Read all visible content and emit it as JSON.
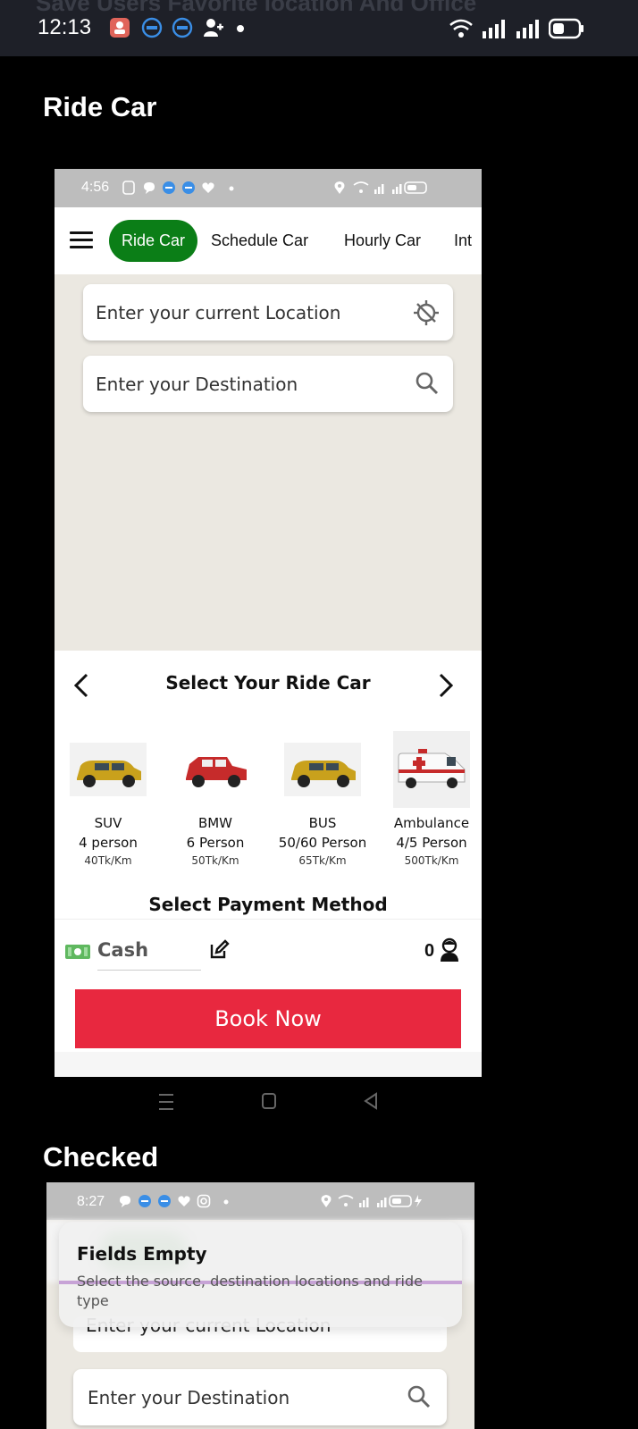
{
  "outer_status": {
    "time": "12:13",
    "ghost_text": "Save Users Favorite location And Office"
  },
  "section1_title": "Ride Car",
  "section2_title": "Checked",
  "screen1": {
    "status_time": "4:56",
    "tabs": [
      "Ride Car",
      "Schedule Car",
      "Hourly Car",
      "Int"
    ],
    "current_location_placeholder": "Enter your current Location",
    "destination_placeholder": "Enter your Destination",
    "select_ride_title": "Select Your Ride Car",
    "cars": [
      {
        "name": "SUV",
        "capacity": "4 person",
        "price": "40Tk/Km"
      },
      {
        "name": "BMW",
        "capacity": "6 Person",
        "price": "50Tk/Km"
      },
      {
        "name": "BUS",
        "capacity": "50/60 Person",
        "price": "65Tk/Km"
      },
      {
        "name": "Ambulance",
        "capacity": "4/5 Person",
        "price": "500Tk/Km"
      }
    ],
    "payment_title": "Select Payment Method",
    "payment_method": "Cash",
    "passenger_count": "0",
    "book_button": "Book Now"
  },
  "screen2": {
    "status_time": "8:27",
    "alert_title": "Fields Empty",
    "alert_message": "Select the source, destination locations and ride type",
    "current_location_placeholder": "Enter your current Location",
    "destination_placeholder": "Enter your Destination"
  },
  "colors": {
    "accent_green": "#0b7e17",
    "book_red": "#e8283f",
    "map_bg": "#ebe8e1"
  }
}
